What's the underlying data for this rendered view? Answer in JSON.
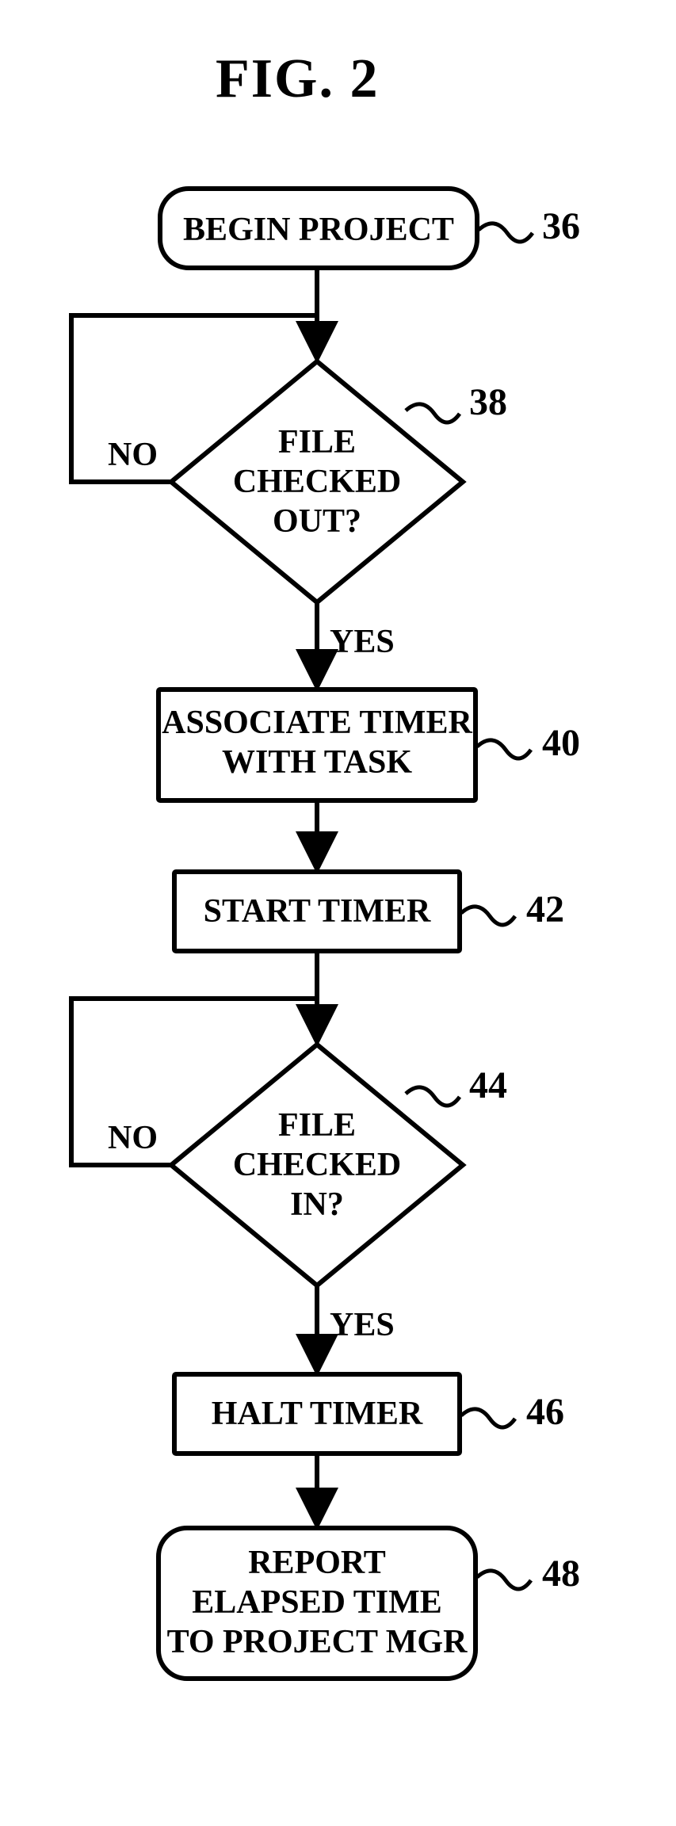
{
  "chart_data": {
    "type": "flowchart",
    "title": "FIG. 2",
    "nodes": [
      {
        "id": 36,
        "shape": "terminator",
        "text": "BEGIN PROJECT"
      },
      {
        "id": 38,
        "shape": "decision",
        "text": "FILE CHECKED OUT?"
      },
      {
        "id": 40,
        "shape": "process",
        "text": "ASSOCIATE TIMER WITH TASK"
      },
      {
        "id": 42,
        "shape": "process",
        "text": "START TIMER"
      },
      {
        "id": 44,
        "shape": "decision",
        "text": "FILE CHECKED IN?"
      },
      {
        "id": 46,
        "shape": "process",
        "text": "HALT TIMER"
      },
      {
        "id": 48,
        "shape": "terminator",
        "text": "REPORT ELAPSED TIME TO PROJECT MGR"
      }
    ],
    "edges": [
      {
        "from": 36,
        "to": 38,
        "label": ""
      },
      {
        "from": 38,
        "to": 38,
        "label": "NO"
      },
      {
        "from": 38,
        "to": 40,
        "label": "YES"
      },
      {
        "from": 40,
        "to": 42,
        "label": ""
      },
      {
        "from": 42,
        "to": 44,
        "label": ""
      },
      {
        "from": 44,
        "to": 44,
        "label": "NO"
      },
      {
        "from": 44,
        "to": 46,
        "label": "YES"
      },
      {
        "from": 46,
        "to": 48,
        "label": ""
      }
    ]
  },
  "title": "FIG. 2",
  "nodes": {
    "n36": {
      "text": "BEGIN PROJECT",
      "ref": "36"
    },
    "n38": {
      "l1": "FILE",
      "l2": "CHECKED",
      "l3": "OUT?",
      "ref": "38"
    },
    "n40": {
      "l1": "ASSOCIATE TIMER",
      "l2": "WITH TASK",
      "ref": "40"
    },
    "n42": {
      "text": "START TIMER",
      "ref": "42"
    },
    "n44": {
      "l1": "FILE",
      "l2": "CHECKED",
      "l3": "IN?",
      "ref": "44"
    },
    "n46": {
      "text": "HALT TIMER",
      "ref": "46"
    },
    "n48": {
      "l1": "REPORT",
      "l2": "ELAPSED TIME",
      "l3": "TO PROJECT MGR",
      "ref": "48"
    }
  },
  "edgeLabels": {
    "no1": "NO",
    "yes1": "YES",
    "no2": "NO",
    "yes2": "YES"
  }
}
